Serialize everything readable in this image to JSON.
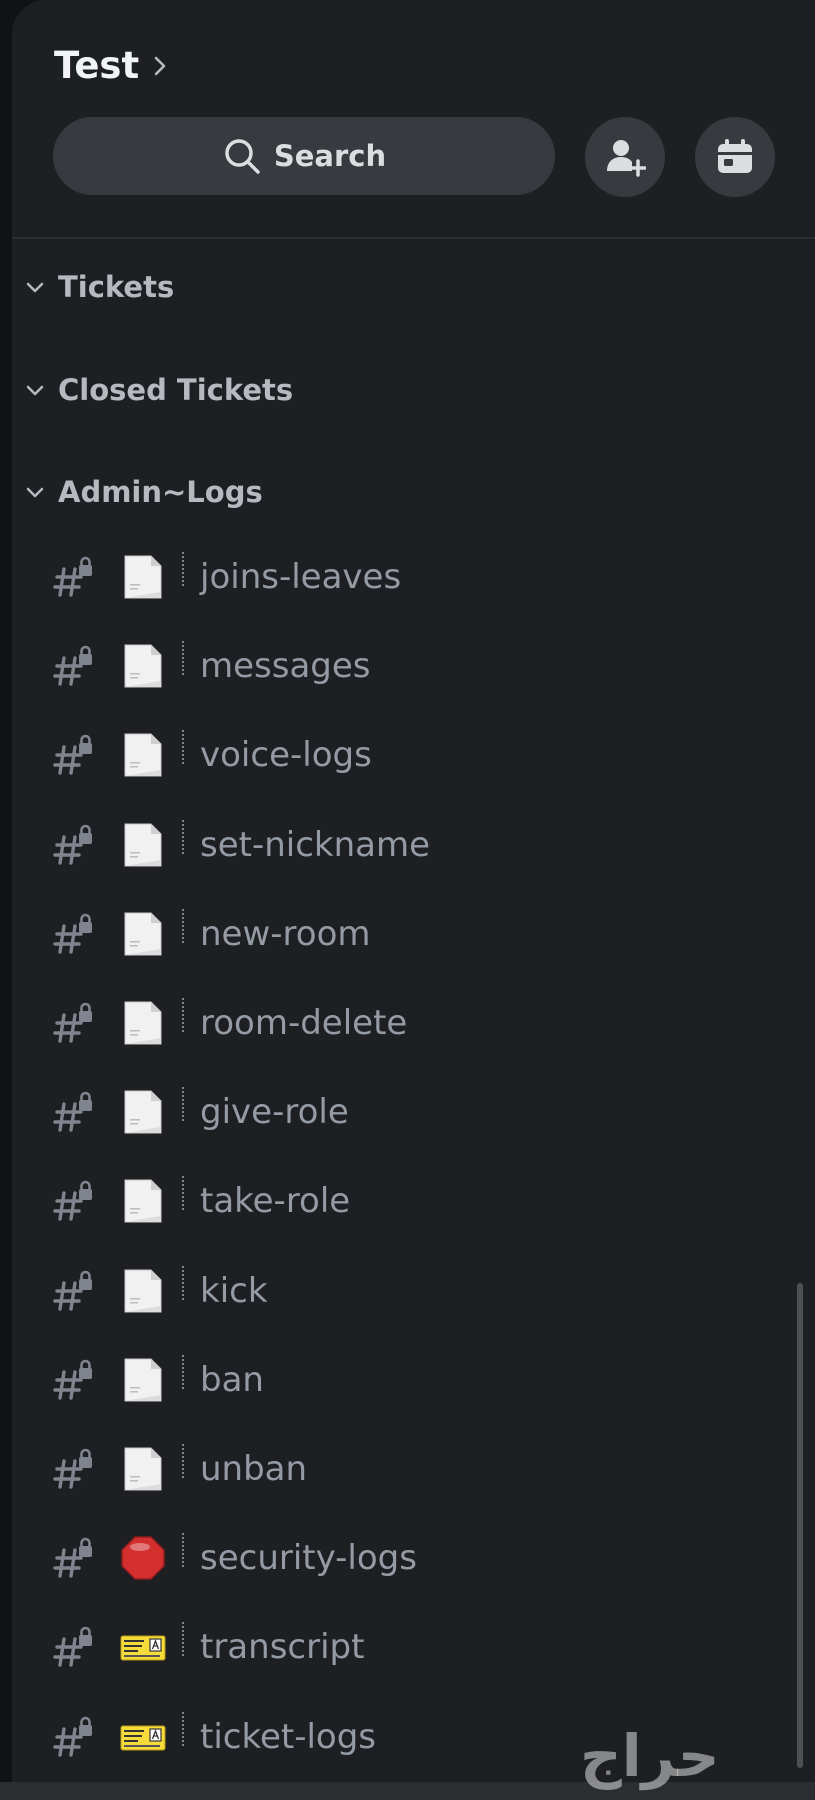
{
  "server": {
    "name": "Test"
  },
  "search": {
    "label": "Search"
  },
  "categories": [
    {
      "label": "Tickets"
    },
    {
      "label": "Closed Tickets"
    },
    {
      "label": "Admin~Logs"
    }
  ],
  "channels": [
    {
      "name": "joins-leaves",
      "emoji": "page-facing-up"
    },
    {
      "name": "messages",
      "emoji": "page-facing-up"
    },
    {
      "name": "voice-logs",
      "emoji": "page-facing-up"
    },
    {
      "name": "set-nickname",
      "emoji": "page-facing-up"
    },
    {
      "name": "new-room",
      "emoji": "page-facing-up"
    },
    {
      "name": "room-delete",
      "emoji": "page-facing-up"
    },
    {
      "name": "give-role",
      "emoji": "page-facing-up"
    },
    {
      "name": "take-role",
      "emoji": "page-facing-up"
    },
    {
      "name": "kick",
      "emoji": "page-facing-up"
    },
    {
      "name": "ban",
      "emoji": "page-facing-up"
    },
    {
      "name": "unban",
      "emoji": "page-facing-up"
    },
    {
      "name": "security-logs",
      "emoji": "stop-sign"
    },
    {
      "name": "transcript",
      "emoji": "ticket"
    },
    {
      "name": "ticket-logs",
      "emoji": "ticket"
    }
  ],
  "watermark": "حراج",
  "colors": {
    "background": "#1e1f22",
    "button": "#383a40",
    "channel_text": "#949ba4",
    "title_text": "#f2f3f5"
  }
}
